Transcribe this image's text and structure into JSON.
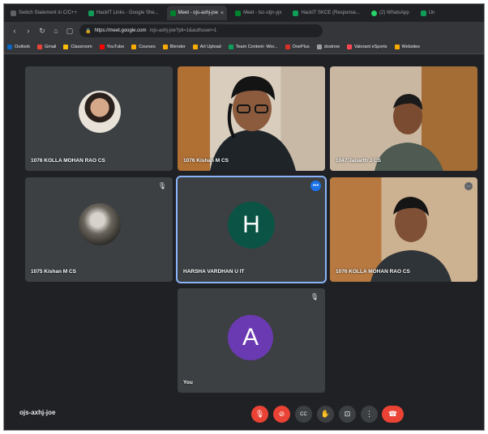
{
  "browser": {
    "tabs": [
      {
        "label": "Switch Statement in C/C++",
        "favicon_color": "#5f6368",
        "active": false
      },
      {
        "label": "HackIT Links - Google She...",
        "favicon_color": "#0f9d58",
        "active": false
      },
      {
        "label": "Meet - ojs-axhj-joe",
        "favicon_color": "#00832d",
        "active": true
      },
      {
        "label": "Meet - tsc-otjn-yjx",
        "favicon_color": "#00832d",
        "active": false
      },
      {
        "label": "HackIT SKCE (Response...",
        "favicon_color": "#0f9d58",
        "active": false
      },
      {
        "label": "(2) WhatsApp",
        "favicon_color": "#25d366",
        "active": false
      },
      {
        "label": "Un",
        "favicon_color": "#0f9d58",
        "active": false
      }
    ],
    "url_host": "https://meet.google.com",
    "url_path": "/ojs-axhj-joe?pli=1&authuser=1",
    "bookmarks": [
      {
        "label": "Outlook",
        "color": "#0a66c2"
      },
      {
        "label": "Gmail",
        "color": "#ea4335"
      },
      {
        "label": "Classroom",
        "color": "#fbbc04"
      },
      {
        "label": "YouTube",
        "color": "#ff0000"
      },
      {
        "label": "Courses",
        "color": "#f9ab00"
      },
      {
        "label": "Blender",
        "color": "#f9ab00"
      },
      {
        "label": "Art Upload",
        "color": "#f9ab00"
      },
      {
        "label": "Team Content- Wor...",
        "color": "#0f9d58"
      },
      {
        "label": "OnePlus",
        "color": "#d93025"
      },
      {
        "label": "dostrow",
        "color": "#9aa0a6"
      },
      {
        "label": "Valorant eSports",
        "color": "#ff4655"
      },
      {
        "label": "Websites",
        "color": "#f9ab00"
      }
    ]
  },
  "meeting": {
    "code": "ojs-axhj-joe",
    "participants": [
      {
        "name": "1076 KOLLA MOHAN RAO CS",
        "kind": "avatar-photo"
      },
      {
        "name": "1076 Kishan M CS",
        "kind": "video"
      },
      {
        "name": "1047 Janarth J CS",
        "kind": "video"
      },
      {
        "name": "1075 Kishan M CS",
        "kind": "avatar-photo",
        "muted": true
      },
      {
        "name": "HARSHA VARDHAN U IT",
        "kind": "initial",
        "initial": "H",
        "color": "#0b5345",
        "speaking": true
      },
      {
        "name": "1076 KOLLA MOHAN RAO CS",
        "kind": "video"
      },
      {
        "name": "You",
        "kind": "initial",
        "initial": "A",
        "color": "#6a3ab2",
        "muted": true
      }
    ]
  },
  "controls": [
    "mic-off",
    "camera-off",
    "captions",
    "raise-hand",
    "present",
    "more-options",
    "end-call"
  ]
}
